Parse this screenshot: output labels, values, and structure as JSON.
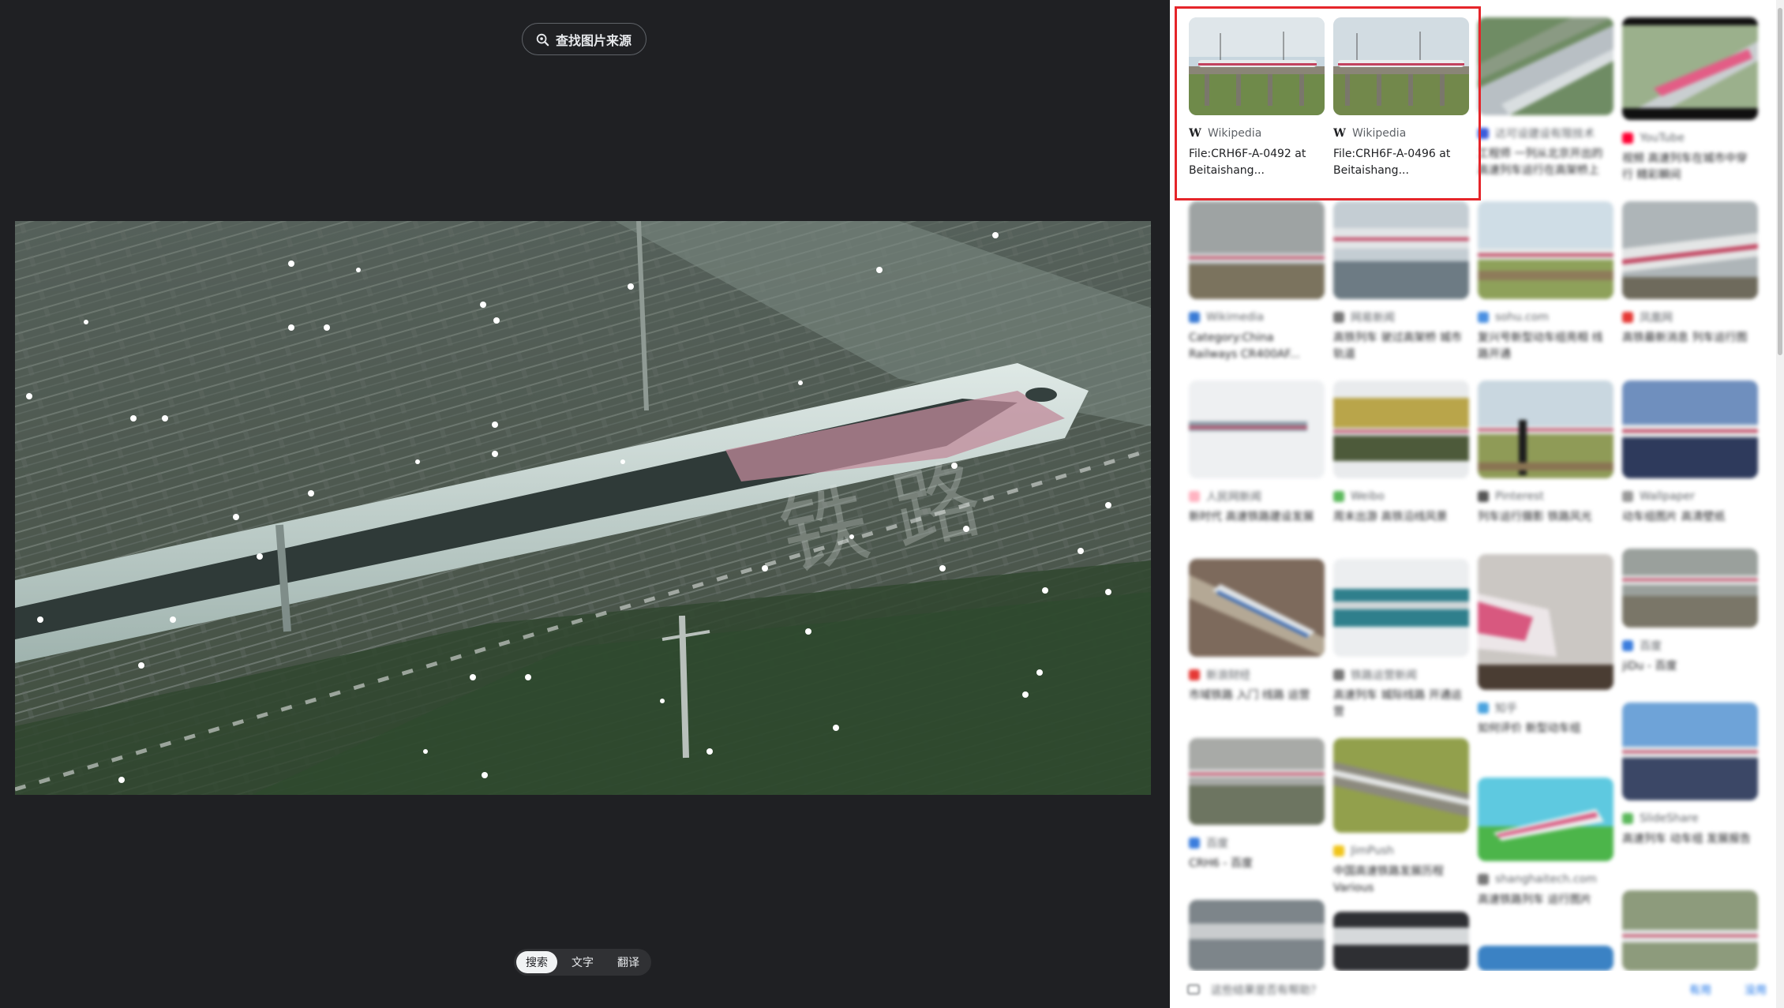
{
  "viewer": {
    "find_source_label": "查找图片来源",
    "tabs": [
      {
        "label": "搜索",
        "active": true
      },
      {
        "label": "文字",
        "active": false
      },
      {
        "label": "翻译",
        "active": false
      }
    ]
  },
  "results": {
    "highlighted": [
      {
        "source": "Wikipedia",
        "title": "File:CRH6F-A-0492 at Beitaishang..."
      },
      {
        "source": "Wikipedia",
        "title": "File:CRH6F-A-0496 at Beitaishang..."
      }
    ],
    "blurred_row1": [
      {
        "source": "达可设建设有限技术",
        "title": "工程师 一列从北京开出的高速列车运行在高架桥上"
      },
      {
        "source": "YouTube",
        "title": "视频 高速列车在城市中穿行 精彩瞬间"
      }
    ],
    "blurred_rows": [
      [
        {
          "source": "Wikimedia",
          "title": "Category:China Railways CR400AF..."
        },
        {
          "source": "网易新闻",
          "title": "高铁列车 驶过高架桥 城市轨道"
        },
        {
          "source": "sohu.com",
          "title": "复兴号新型动车组亮相 线路开通"
        },
        {
          "source": "凤凰网",
          "title": "高铁最新消息 列车运行图"
        }
      ],
      [
        {
          "source": "人民网新闻",
          "title": "新时代 高速铁路建设发展"
        },
        {
          "source": "Weibo",
          "title": "周末出游 高铁沿线风景"
        },
        {
          "source": "Pinterest",
          "title": "列车运行摄影 铁路风光"
        },
        {
          "source": "Wallpaper",
          "title": "动车组图片 高清壁纸"
        }
      ],
      [
        {
          "source": "新浪财经",
          "title": "市域铁路 入门 线路 运营"
        },
        {
          "source": "铁路运营新闻",
          "title": "高速列车 城际线路 开通运营"
        },
        {
          "source": "知乎",
          "title": "如何评价 新型动车组"
        },
        {
          "source": "百度",
          "title": "jiDu - 百度"
        }
      ],
      [
        {
          "source": "百度",
          "title": "CRH6 - 百度"
        },
        {
          "source": "JimPush",
          "title": "中国高速铁路发展历程 Various"
        },
        {
          "source": "shanghaitech.com",
          "title": "高速铁路列车 运行图片"
        },
        {
          "source": "SlideShare",
          "title": "高速列车 动车组 发展报告"
        }
      ]
    ],
    "feedback_text": "这些结果是否有帮助？",
    "feedback_yes": "有用",
    "feedback_no": "没用"
  },
  "colors": {
    "viewer_bg": "#1f2023",
    "highlight_border": "#e5252a",
    "link_blue": "#1a73e8"
  },
  "icons": [
    "lens-search-icon",
    "wikipedia-icon",
    "favicon-icon",
    "feedback-icon"
  ]
}
